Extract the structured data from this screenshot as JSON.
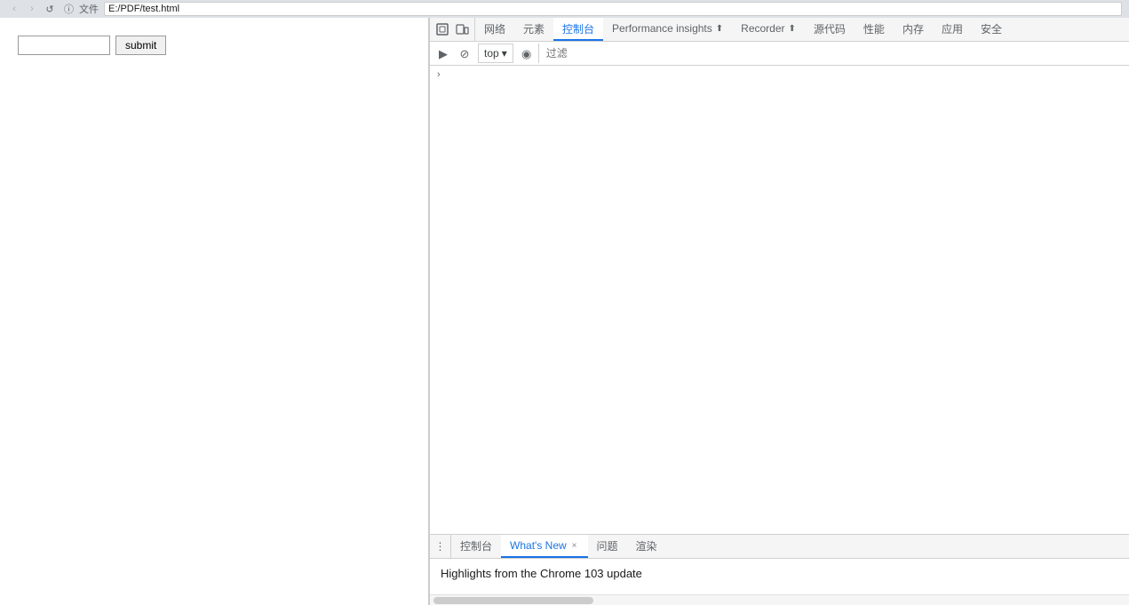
{
  "browser": {
    "address": "E:/PDF/test.html",
    "file_label": "文件"
  },
  "nav": {
    "back": "‹",
    "forward": "›",
    "refresh": "↺",
    "security": "ⓘ"
  },
  "page": {
    "input_placeholder": "",
    "submit_label": "submit"
  },
  "devtools": {
    "tabs": [
      {
        "label": "网络",
        "active": false
      },
      {
        "label": "元素",
        "active": false
      },
      {
        "label": "控制台",
        "active": true
      },
      {
        "label": "Performance insights",
        "active": false,
        "has_icon": true
      },
      {
        "label": "Recorder",
        "active": false,
        "has_icon": true
      },
      {
        "label": "源代码",
        "active": false
      },
      {
        "label": "性能",
        "active": false
      },
      {
        "label": "内存",
        "active": false
      },
      {
        "label": "应用",
        "active": false
      },
      {
        "label": "安全",
        "active": false
      }
    ],
    "toolbar_icons": {
      "inspect": "⬚",
      "device": "⬕"
    },
    "secondary_toolbar": {
      "run_icon": "▶",
      "stop_icon": "⊘",
      "top_label": "top",
      "eye_icon": "◉",
      "filter_placeholder": "过滤"
    },
    "console_prompt_symbol": "›"
  },
  "drawer": {
    "menu_icon": "⋮",
    "tabs": [
      {
        "label": "控制台",
        "active": false,
        "closable": false
      },
      {
        "label": "What's New",
        "active": true,
        "closable": true
      },
      {
        "label": "问题",
        "active": false,
        "closable": false
      },
      {
        "label": "渲染",
        "active": false,
        "closable": false
      }
    ],
    "content_text": "Highlights from the Chrome 103 update"
  },
  "colors": {
    "active_tab_color": "#1a73e8",
    "active_tab_border": "#1a73e8"
  }
}
